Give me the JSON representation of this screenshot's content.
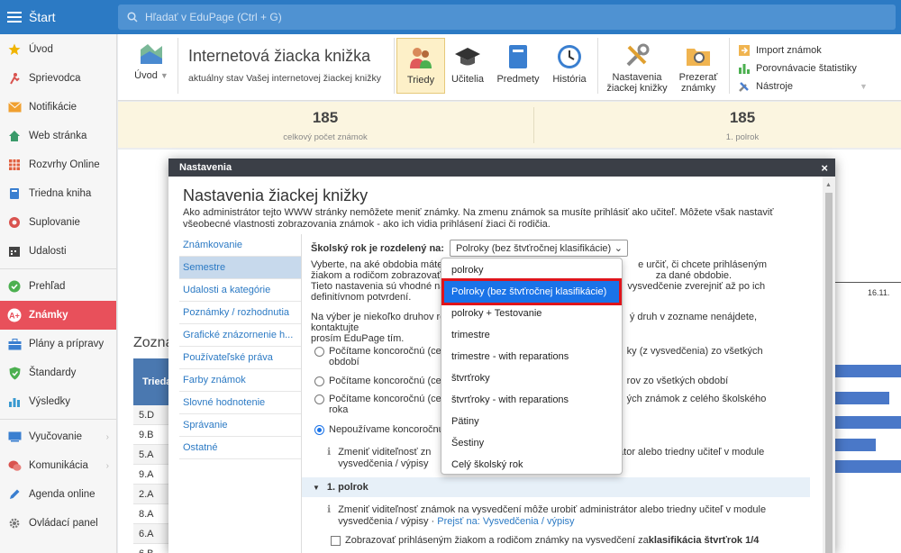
{
  "topbar": {
    "start_label": "Štart",
    "search_placeholder": "Hľadať v EduPage (Ctrl + G)"
  },
  "sidebar": {
    "items": [
      {
        "label": "Úvod",
        "icon": "star-icon"
      },
      {
        "label": "Sprievodca",
        "icon": "guide-icon"
      },
      {
        "label": "Notifikácie",
        "icon": "envelope-icon"
      },
      {
        "label": "Web stránka",
        "icon": "home-icon"
      },
      {
        "label": "Rozvrhy Online",
        "icon": "timetable-icon"
      },
      {
        "label": "Triedna kniha",
        "icon": "book-icon"
      },
      {
        "label": "Suplovanie",
        "icon": "lifebuoy-icon"
      },
      {
        "label": "Udalosti",
        "icon": "calendar-icon"
      },
      {
        "label": "Prehľad",
        "icon": "check-circle-icon"
      },
      {
        "label": "Známky",
        "icon": "grades-icon"
      },
      {
        "label": "Plány a prípravy",
        "icon": "briefcase-icon"
      },
      {
        "label": "Štandardy",
        "icon": "shield-icon"
      },
      {
        "label": "Výsledky",
        "icon": "chart-icon"
      },
      {
        "label": "Vyučovanie",
        "icon": "lessons-icon"
      },
      {
        "label": "Komunikácia",
        "icon": "chat-icon"
      },
      {
        "label": "Agenda online",
        "icon": "pen-icon"
      },
      {
        "label": "Ovládací panel",
        "icon": "gear-icon"
      }
    ]
  },
  "toolbar": {
    "uvod_label": "Úvod",
    "title": "Internetová žiacka knižka",
    "subtitle": "aktuálny stav Vašej internetovej žiackej knižky",
    "tabs": {
      "triedy": "Triedy",
      "ucitelia": "Učitelia",
      "predmety": "Predmety",
      "historia": "História"
    },
    "nastavenia_l1": "Nastavenia",
    "nastavenia_l2": "žiackej knižky",
    "prezerat_l1": "Prezerať",
    "prezerat_l2": "známky",
    "tools": {
      "import": "Import známok",
      "compare": "Porovnávacie štatistiky",
      "nastroje": "Nástroje"
    }
  },
  "stats": {
    "total_value": "185",
    "total_label": "celkový počet známok",
    "half_value": "185",
    "half_label": "1. polrok"
  },
  "background": {
    "title": "Zozna",
    "col_header": "Trieda",
    "rows": [
      "5.D",
      "9.B",
      "5.A",
      "9.A",
      "2.A",
      "8.A",
      "6.A",
      "6.B"
    ],
    "date_label": "16.11."
  },
  "dialog": {
    "header": "Nastavenia",
    "close": "×",
    "title": "Nastavenia žiackej knižky",
    "desc": "Ako administrátor tejto WWW stránky nemôžete meniť známky. Na zmenu známok sa musíte prihlásiť ako učiteľ. Môžete však nastaviť všeobecné vlastnosti zobrazovania známok - ako ich vidia prihlásení žiaci či rodičia.",
    "nav": [
      "Známkovanie",
      "Semestre",
      "Udalosti a kategórie",
      "Poznámky / rozhodnutia",
      "Grafické znázornenie h...",
      "Používateľské práva",
      "Farby známok",
      "Slovné hodnotenie",
      "Správanie",
      "Ostatné"
    ],
    "select_label": "Školský rok je rozdelený na:",
    "select_value": "Polroky (bez štvťročnej klasifikácie)",
    "p1_l1": "Vyberte, na aké obdobia máte r",
    "p1_l1b": "e určiť, či chcete prihláseným",
    "p1_l2": "žiakom a rodičom zobrazovať z",
    "p1_l2b": "za dané obdobie.",
    "p1_l3": "Tieto nastavenia sú vhodné na",
    "p1_l3b": "vysvedčenie zverejniť až po ich",
    "p1_l4": "definitívnom potvrdení.",
    "p2_l1": "Na výber je niekoľko druhov roz",
    "p2_l1b": "ý druh v zozname nenájdete, kontaktujte",
    "p2_l2": "prosím EduPage tím.",
    "r1_l1": "Počítame koncoročnú (celk",
    "r1_l1b": "ky (z vysvedčenia) zo všetkých",
    "r1_l2": "období",
    "r2_l1": "Počítame koncoročnú (celk",
    "r2_l1b": "rov zo všetkých období",
    "r3_l1": "Počítame koncoročnú (celk",
    "r3_l1b": "ých známok z celého školského",
    "r3_l2": "roka",
    "r4_l1": "Nepoužívame koncoročnú",
    "info1_l1": "Zmeniť viditeľnosť zn",
    "info1_l1b": "rátor alebo triedny učiteľ v module",
    "info1_l2": "vysvedčenia / výpisy",
    "section": "1. polrok",
    "info2_l1": "Zmeniť viditeľnosť známok na vysvedčení môže urobiť administrátor alebo triedny učiteľ v module",
    "info2_l2a": "vysvedčenia / výpisy · ",
    "info2_link": "Prejsť na: Vysvedčenia / výpisy",
    "checkbox_a": "Zobrazovať prihláseným žiakom a rodičom známky na vysvedčení za ",
    "checkbox_b": "klasifikácia štvrťrok 1/4",
    "options": [
      "polroky",
      "Polroky (bez štvťročnej klasifikácie)",
      "polroky + Testovanie",
      "trimestre",
      "trimestre - with reparations",
      "štvrťroky",
      "štvrťroky - with reparations",
      "Pätiny",
      "Šestiny",
      "Celý školský rok"
    ],
    "selected_index": 1
  },
  "colors": {
    "accent": "#2c7ac4",
    "active_nav": "#e8505b",
    "highlight": "#e0141b",
    "option_selected": "#1a73e8"
  }
}
